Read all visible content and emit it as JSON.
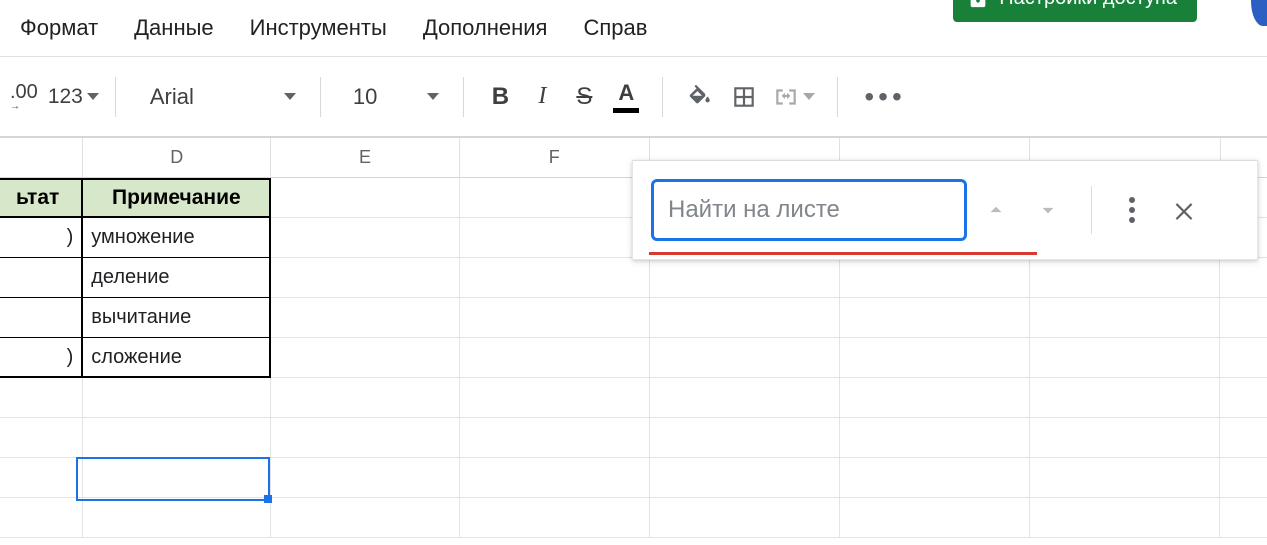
{
  "menu": {
    "format": "Формат",
    "data": "Данные",
    "tools": "Инструменты",
    "addons": "Дополнения",
    "help": "Справ"
  },
  "share_button": "Настройки доступа",
  "toolbar": {
    "dec_places": ".00",
    "number_format": "123",
    "font_name": "Arial",
    "font_size": "10",
    "bold": "B",
    "italic": "I",
    "strike": "S",
    "textcolor": "A"
  },
  "columns": {
    "D": "D",
    "E": "E",
    "F": "F"
  },
  "table": {
    "header_c": "ьтат",
    "header_d": "Примечание",
    "rows": [
      {
        "c": ")",
        "d": "умножение"
      },
      {
        "c": "",
        "d": "деление"
      },
      {
        "c": "",
        "d": "вычитание"
      },
      {
        "c": ")",
        "d": "сложение"
      }
    ]
  },
  "find": {
    "placeholder": "Найти на листе"
  }
}
